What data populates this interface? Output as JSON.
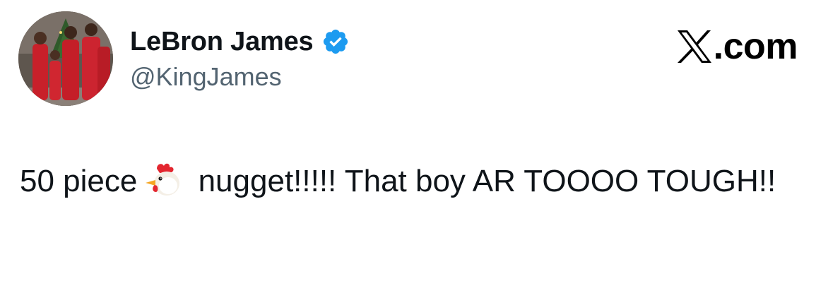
{
  "author": {
    "display_name": "LeBron James",
    "handle": "@KingJames",
    "verified": true,
    "avatar_icon": "family-photo-avatar"
  },
  "brand": {
    "text": ".com",
    "logo_icon": "x-logo-icon"
  },
  "tweet": {
    "text_before": "50 piece",
    "emoji_icon": "chicken-emoji-icon",
    "text_after": " nugget!!!!! That boy AR TOOOO TOUGH!!"
  },
  "colors": {
    "text_primary": "#0f1419",
    "text_secondary": "#536471",
    "verified_blue": "#1d9bf0"
  }
}
